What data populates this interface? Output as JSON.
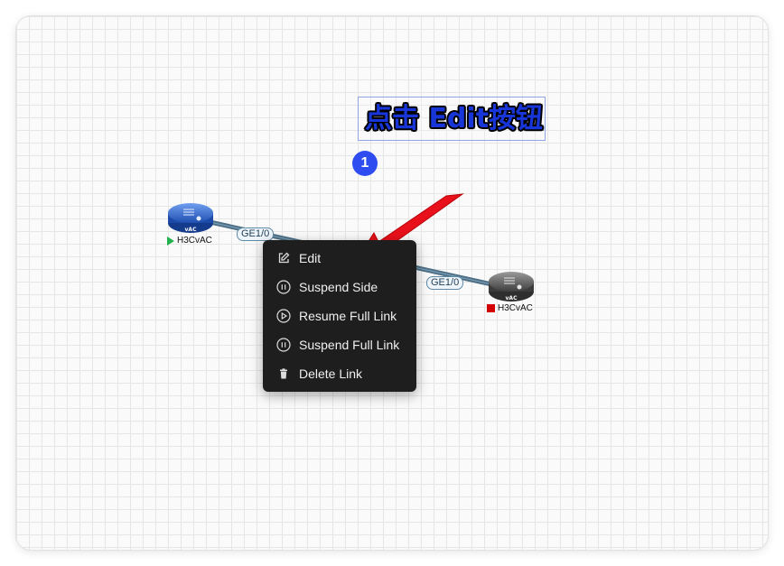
{
  "topology": {
    "devices": [
      {
        "name": "H3CvAC",
        "badge": "vAC",
        "status": "running",
        "color": "#2f6bd8",
        "status_color": "#22b14c"
      },
      {
        "name": "H3CvAC",
        "badge": "vAC",
        "status": "stopped",
        "color": "#666666",
        "status_color": "#d40000"
      }
    ],
    "link": {
      "color": "#4d6f86",
      "ports": [
        "GE1/0",
        "GE1/0"
      ]
    }
  },
  "annotation": {
    "text": "点击 Edit按钮",
    "step": "1",
    "arrow_color": "#e8101a"
  },
  "context_menu": {
    "items": [
      {
        "label": "Edit",
        "icon": "edit-icon"
      },
      {
        "label": "Suspend Side",
        "icon": "pause-circle-icon"
      },
      {
        "label": "Resume Full Link",
        "icon": "play-circle-icon"
      },
      {
        "label": "Suspend Full Link",
        "icon": "pause-circle-icon"
      },
      {
        "label": "Delete Link",
        "icon": "trash-icon"
      }
    ]
  }
}
